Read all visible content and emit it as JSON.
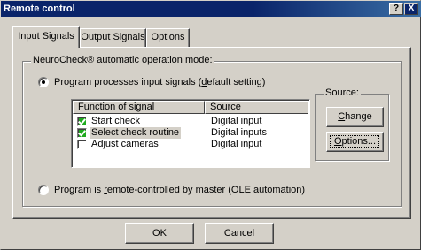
{
  "window": {
    "title": "Remote control",
    "help_btn": "?",
    "close_btn": "X"
  },
  "tabs": [
    {
      "label": "Input Signals",
      "active": true
    },
    {
      "label": "Output Signals",
      "active": false
    },
    {
      "label": "Options",
      "active": false
    }
  ],
  "mode_group": {
    "legend": "NeuroCheck® automatic operation mode:",
    "radio_input": {
      "pre": "Program processes input signals (",
      "underline": "d",
      "post": "efault setting)",
      "selected": true
    },
    "radio_remote": {
      "pre": "Program is ",
      "underline": "r",
      "post": "emote-controlled by master (OLE automation)",
      "selected": false
    }
  },
  "signal_list": {
    "columns": [
      "Function of signal",
      "Source"
    ],
    "rows": [
      {
        "function": "Start check",
        "source": "Digital input",
        "checked": true
      },
      {
        "function": "Select check routine",
        "source": "Digital inputs",
        "checked": true
      },
      {
        "function": "Adjust cameras",
        "source": "Digital input",
        "checked": false
      }
    ]
  },
  "source_group": {
    "legend": "Source:",
    "change_button": {
      "underline": "C",
      "rest": "hange"
    },
    "options_button": {
      "underline": "O",
      "rest": "ptions..."
    }
  },
  "footer": {
    "ok": "OK",
    "cancel": "Cancel"
  }
}
